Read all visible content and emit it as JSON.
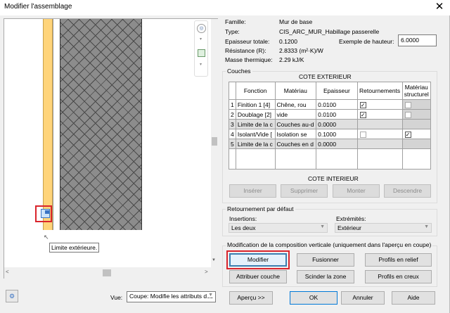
{
  "window": {
    "title": "Modifier l'assemblage",
    "close_glyph": "✕"
  },
  "props": {
    "family_label": "Famille:",
    "family_value": "Mur de base",
    "type_label": "Type:",
    "type_value": "CIS_ARC_MUR_Habillage passerelle",
    "thickness_label": "Epaisseur totale:",
    "thickness_value": "0.1200",
    "height_label": "Exemple de hauteur:",
    "height_value": "6.0000",
    "resistance_label": "Résistance (R):",
    "resistance_value": "2.8333 (m²·K)/W",
    "thermal_label": "Masse thermique:",
    "thermal_value": "2.29 kJ/K"
  },
  "layers": {
    "group_label": "Couches",
    "exterior_label": "COTE EXTERIEUR",
    "interior_label": "COTE INTERIEUR",
    "headers": [
      "Fonction",
      "Matériau",
      "Epaisseur",
      "Retournements",
      "Matériau structurel"
    ],
    "rows": [
      {
        "num": "1",
        "func": "Finition 1 [4]",
        "mat": "Chêne, rou",
        "thick": "0.0100",
        "wrap": true,
        "struct": false,
        "bold": false
      },
      {
        "num": "2",
        "func": "Doublage [2]",
        "mat": "vide",
        "thick": "0.0100",
        "wrap": true,
        "struct": false,
        "bold": false
      },
      {
        "num": "3",
        "func": "Limite de la c",
        "mat": "Couches au-d",
        "thick": "0.0000",
        "bold": true
      },
      {
        "num": "4",
        "func": "Isolant/Vide [",
        "mat": "Isolation se",
        "thick": "0.1000",
        "wrap": false,
        "struct": true,
        "bold": false
      },
      {
        "num": "5",
        "func": "Limite de la c",
        "mat": "Couches en d",
        "thick": "0.0000",
        "bold": true
      }
    ],
    "buttons": {
      "insert": "Insérer",
      "delete": "Supprimer",
      "up": "Monter",
      "down": "Descendre"
    }
  },
  "wrapping": {
    "group_label": "Retournement par défaut",
    "insertions_label": "Insertions:",
    "insertions_value": "Les deux",
    "ends_label": "Extrémités:",
    "ends_value": "Extérieur"
  },
  "vertical": {
    "group_label": "Modification de la composition verticale (uniquement dans l'aperçu en coupe)",
    "buttons": {
      "modify": "Modifier",
      "merge": "Fusionner",
      "sweeps": "Profils en relief",
      "assign": "Attribuer couche",
      "split": "Scinder la zone",
      "reveals": "Profils en creux"
    }
  },
  "footer": {
    "view_label": "Vue:",
    "view_value": "Coupe: Modifie les attributs des",
    "preview": "Aperçu >>",
    "ok": "OK",
    "cancel": "Annuler",
    "help": "Aide"
  },
  "preview": {
    "tooltip": "Limite extérieure."
  }
}
